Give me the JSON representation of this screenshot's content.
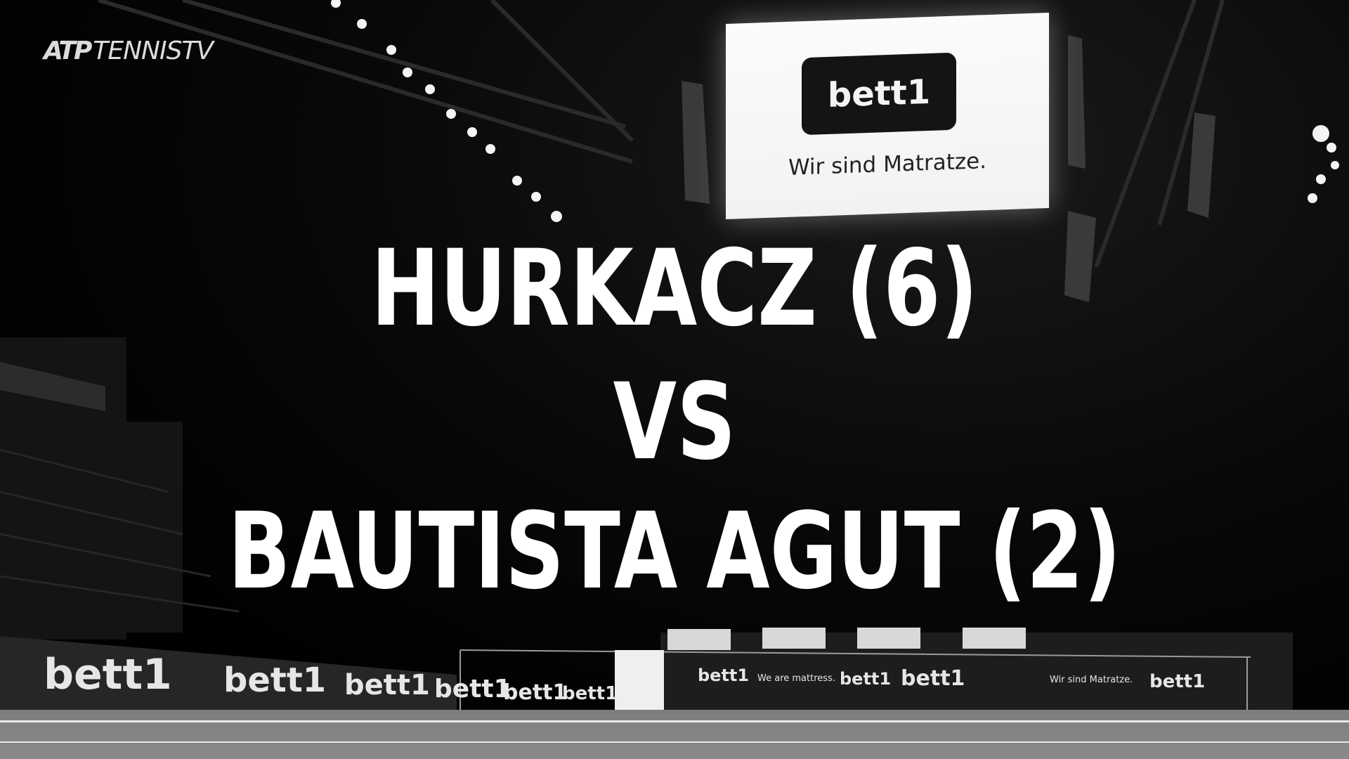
{
  "broadcaster_logo": {
    "atp": "ATP",
    "name": "TENNIS",
    "tv": "TV"
  },
  "jumbotron": {
    "brand": "bett1",
    "tagline": "Wir sind Matratze."
  },
  "matchup": {
    "player1": "HURKACZ (6)",
    "versus": "VS",
    "player2": "BAUTISTA AGUT (2)"
  },
  "court_boards": [
    {
      "text": "bett1"
    },
    {
      "text": "bett1"
    },
    {
      "text": "bett1"
    },
    {
      "text": "bett1"
    },
    {
      "text": "bett1"
    },
    {
      "text": "bett1"
    },
    {
      "text": "bett1"
    },
    {
      "text": "bett1"
    },
    {
      "text": "bett1"
    },
    {
      "text": "bett1"
    }
  ],
  "rear_boards": [
    {
      "text": "We are mattress."
    },
    {
      "text": "Wir sind Matratze."
    }
  ],
  "colors": {
    "background": "#000000",
    "text": "#ffffff",
    "screen": "#f4f4f4"
  }
}
